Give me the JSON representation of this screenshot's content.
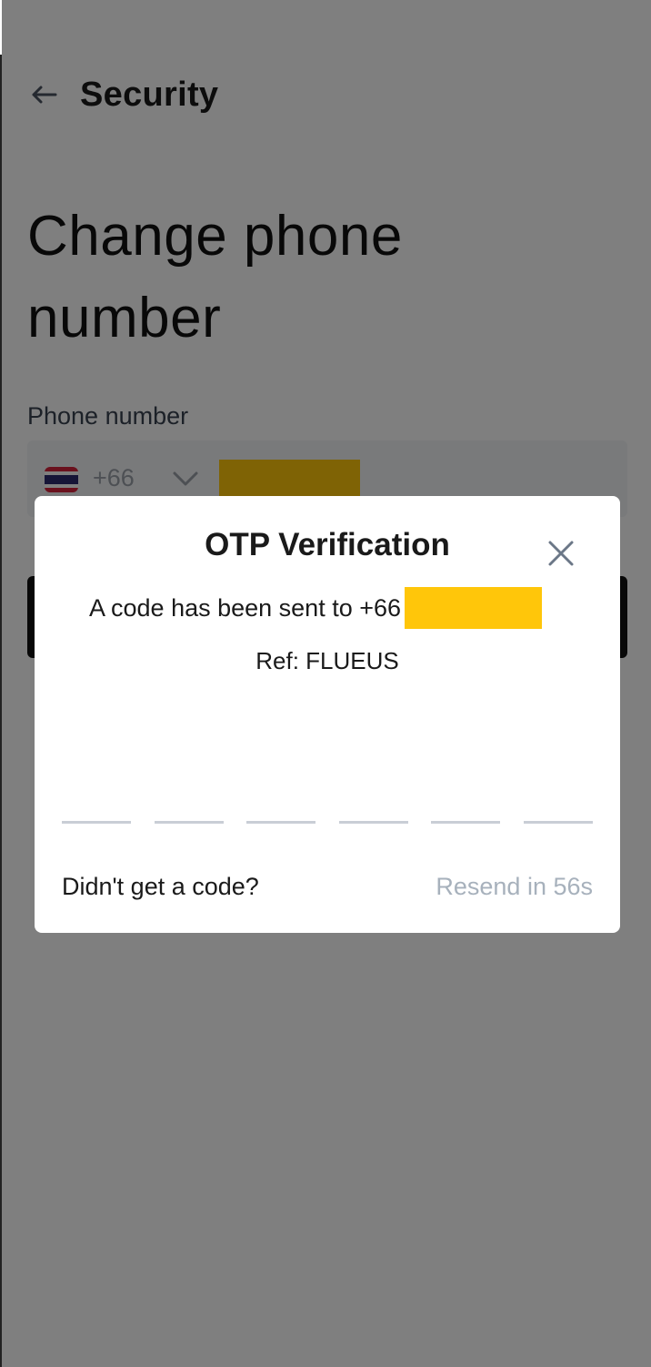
{
  "header": {
    "title": "Security",
    "back_icon": "arrow-left-icon"
  },
  "page": {
    "title": "Change phone number",
    "phone_label": "Phone number",
    "country_code": "+66",
    "flag_icon": "thailand-flag-icon",
    "dropdown_icon": "chevron-down-icon",
    "button_color": "#111111"
  },
  "modal": {
    "title": "OTP Verification",
    "sent_text": "A code has been sent to +66",
    "ref_text": "Ref: FLUEUS",
    "otp_digits": [
      "",
      "",
      "",
      "",
      "",
      ""
    ],
    "didnt_get": "Didn't get a code?",
    "resend": "Resend in 56s",
    "close_icon": "close-icon"
  },
  "colors": {
    "overlay": "rgba(0,0,0,0.5)",
    "redaction": "#ffc60a",
    "muted_text": "#a7b1bc"
  }
}
